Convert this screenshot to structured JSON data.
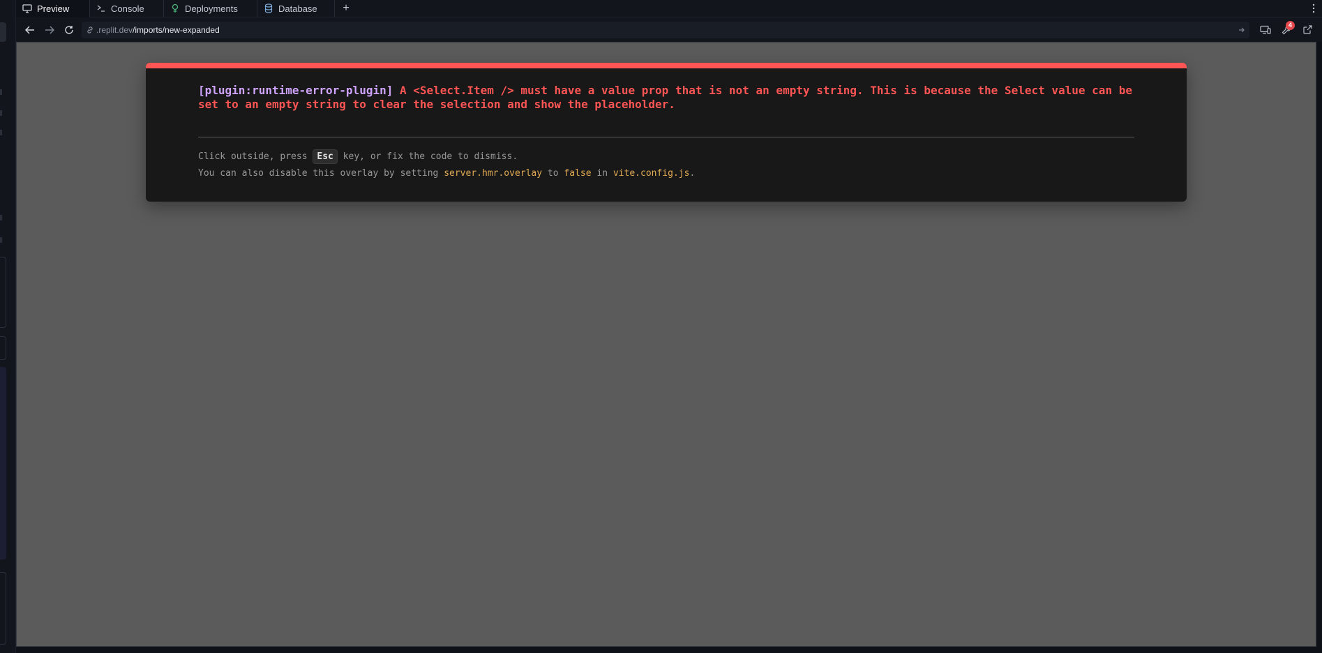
{
  "tabs": [
    {
      "label": "Preview",
      "icon": "monitor-icon",
      "active": true
    },
    {
      "label": "Console",
      "icon": "terminal-icon",
      "active": false
    },
    {
      "label": "Deployments",
      "icon": "deployments-icon",
      "active": false
    },
    {
      "label": "Database",
      "icon": "database-icon",
      "active": false
    }
  ],
  "tab_add_label": "+",
  "address": {
    "host": ".replit.dev",
    "path": "/imports/new-expanded"
  },
  "badge_count": "4",
  "overlay": {
    "plugin": "[plugin:runtime-error-plugin]",
    "message": " A <Select.Item /> must have a value prop that is not an empty string. This is because the Select value can be set to an empty string to clear the selection and show the placeholder.",
    "tip_line1_a": "Click outside, press ",
    "tip_key": "Esc",
    "tip_line1_b": " key, or fix the code to dismiss.",
    "tip_line2_a": "You can also disable this overlay by setting ",
    "tip_code1": "server.hmr.overlay",
    "tip_line2_b": " to ",
    "tip_code2": "false",
    "tip_line2_c": " in ",
    "tip_code3": "vite.config.js",
    "tip_line2_d": "."
  },
  "colors": {
    "error_red": "#ff5555",
    "plugin_purple": "#cfa4ff",
    "code_yellow": "#e2aa53",
    "preview_bg": "#5b5b5b"
  }
}
